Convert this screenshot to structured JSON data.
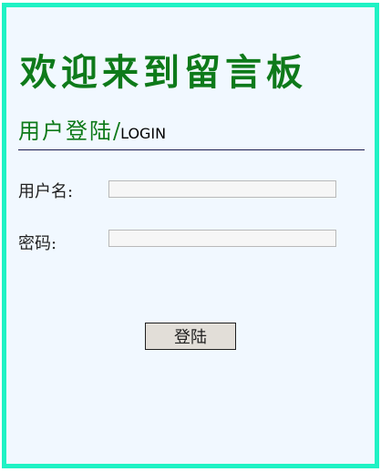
{
  "header": {
    "welcome_title": "欢迎来到留言板",
    "login_cn": "用户登陆",
    "slash": "/",
    "login_en": "LOGIN"
  },
  "form": {
    "username_label": "用户名:",
    "username_value": "",
    "password_label": "密码:",
    "password_value": "",
    "submit_label": "登陆"
  },
  "colors": {
    "frame_border": "#1ff2c4",
    "background": "#f1f8ff",
    "title_green": "#0e7a1a"
  }
}
